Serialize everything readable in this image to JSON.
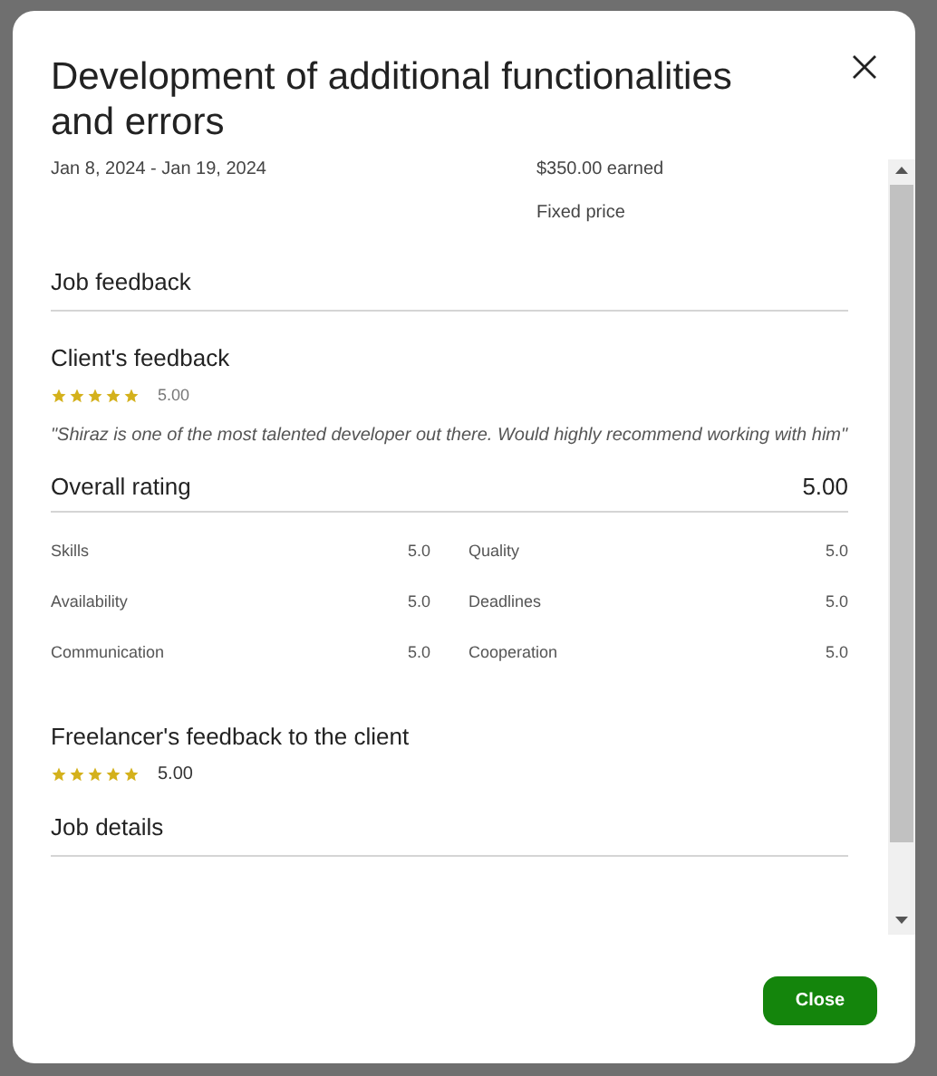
{
  "dialog": {
    "title": "Development of additional functionalities and errors",
    "dates": "Jan 8, 2024 - Jan 19, 2024",
    "earned": "$350.00 earned",
    "price_type": "Fixed price"
  },
  "job_feedback": {
    "heading": "Job feedback"
  },
  "client_feedback": {
    "heading": "Client's feedback",
    "stars": 5,
    "score": "5.00",
    "comment": "\"Shiraz is one of the most talented developer out there. Would highly recommend working with him\""
  },
  "overall": {
    "label": "Overall rating",
    "score": "5.00"
  },
  "ratings": [
    {
      "label": "Skills",
      "value": "5.0"
    },
    {
      "label": "Quality",
      "value": "5.0"
    },
    {
      "label": "Availability",
      "value": "5.0"
    },
    {
      "label": "Deadlines",
      "value": "5.0"
    },
    {
      "label": "Communication",
      "value": "5.0"
    },
    {
      "label": "Cooperation",
      "value": "5.0"
    }
  ],
  "freelancer_feedback": {
    "heading": "Freelancer's feedback to the client",
    "stars": 5,
    "score": "5.00"
  },
  "job_details": {
    "heading": "Job details"
  },
  "buttons": {
    "close": "Close"
  }
}
